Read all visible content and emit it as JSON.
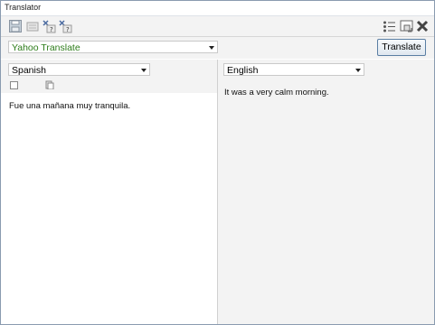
{
  "window": {
    "title": "Translator"
  },
  "toolbar": {
    "left_icons": [
      "save-icon",
      "clear-icon",
      "swap-icon",
      "swap-reverse-icon"
    ],
    "right_icons": [
      "list-icon",
      "window-icon",
      "close-icon"
    ]
  },
  "service": {
    "selected": "Yahoo Translate",
    "color": "#2e7d1b"
  },
  "translate_button": {
    "label": "Translate"
  },
  "source": {
    "language": "Spanish",
    "text": "Fue una mañana muy tranquila."
  },
  "target": {
    "language": "English",
    "text": "It was a very calm morning."
  }
}
